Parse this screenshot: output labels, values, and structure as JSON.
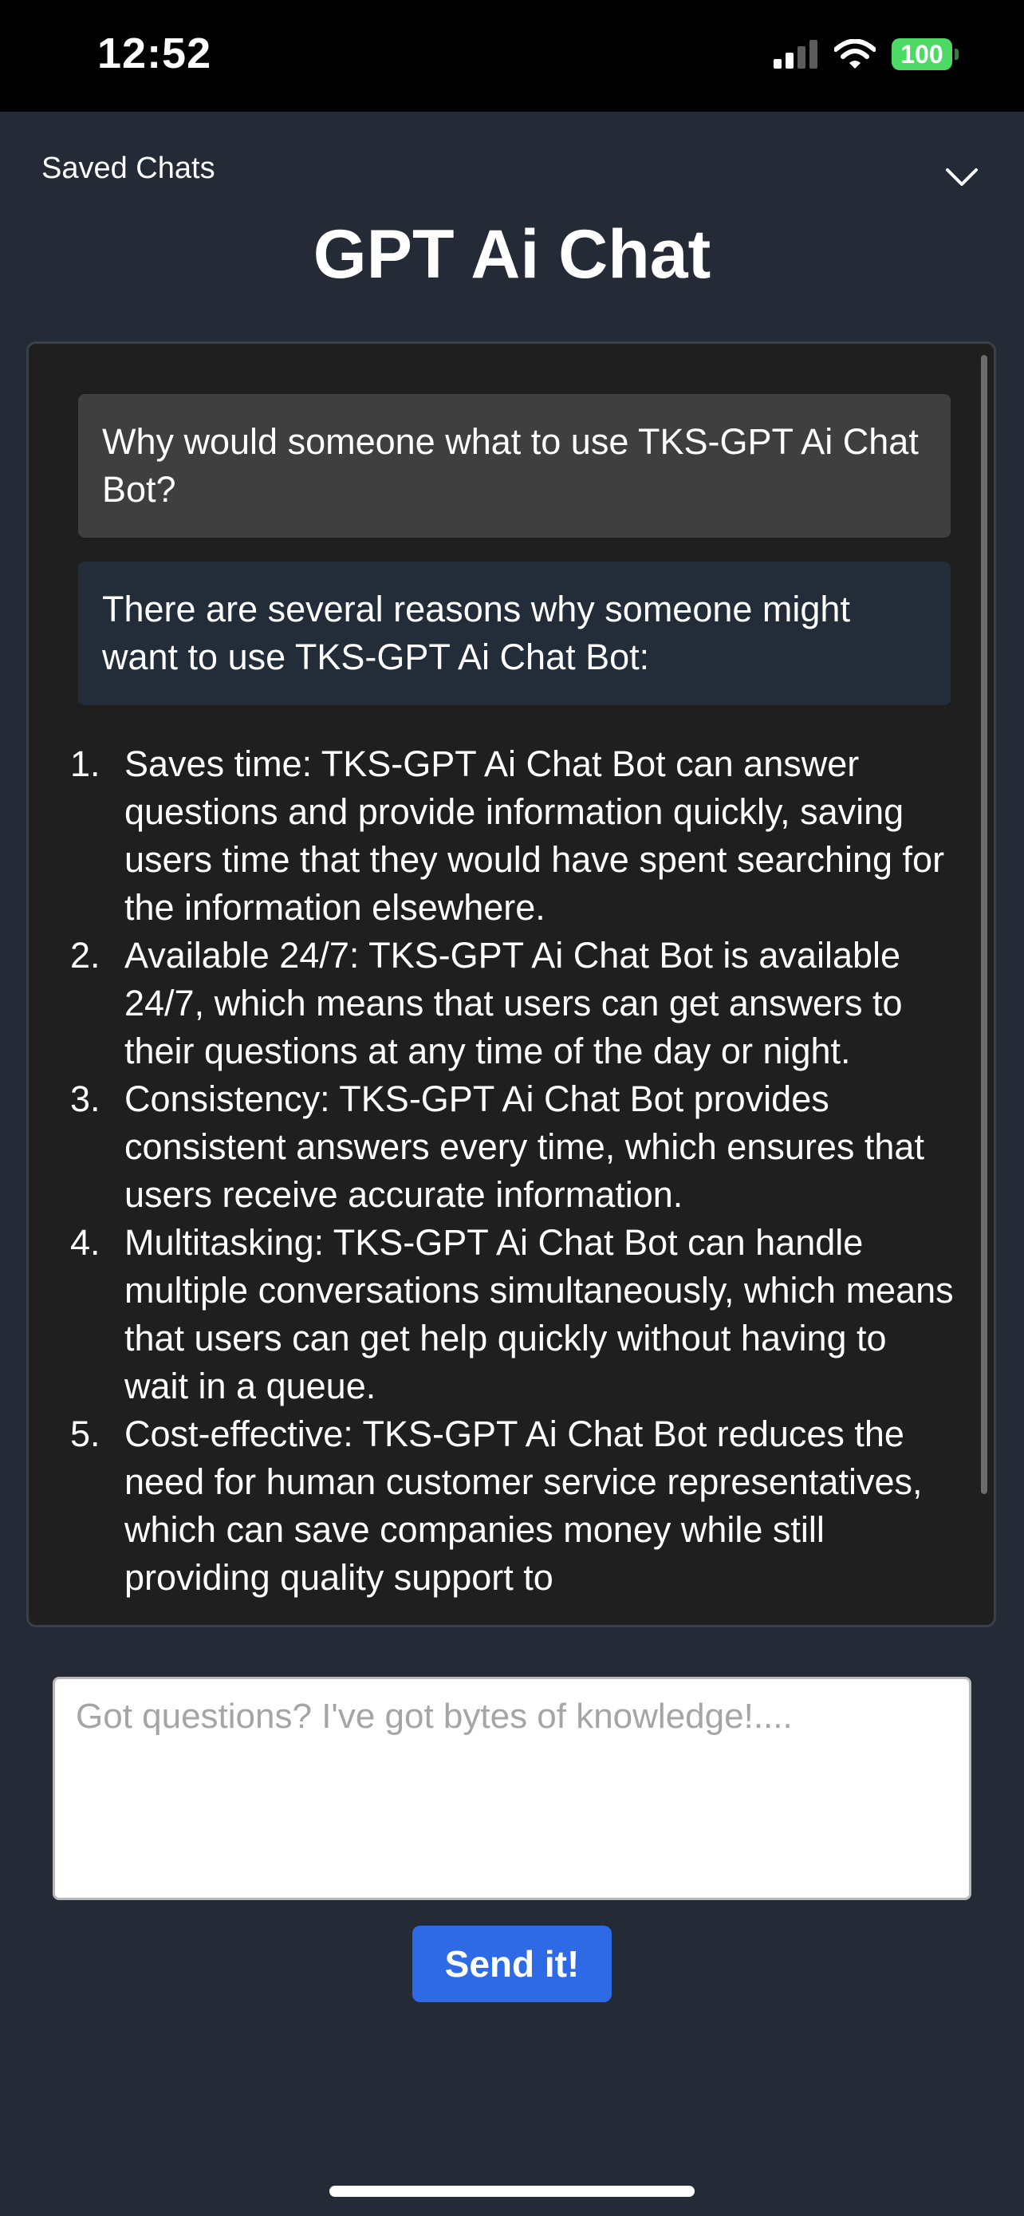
{
  "status_bar": {
    "time": "12:52",
    "battery": "100",
    "icons": [
      "signal-icon",
      "wifi-icon",
      "battery-icon"
    ],
    "battery_color": "#4cd964"
  },
  "header": {
    "saved_chats_label": "Saved Chats",
    "dropdown_icon": "chevron-down-icon",
    "title": "GPT Ai Chat"
  },
  "chat": {
    "messages": [
      {
        "role": "user",
        "text": "Why would someone what to use TKS-GPT Ai Chat Bot?"
      },
      {
        "role": "assistant",
        "text": "There are several reasons why someone might want to use TKS-GPT Ai Chat Bot:"
      }
    ],
    "list": [
      {
        "num": "1.",
        "text": "Saves time: TKS-GPT Ai Chat Bot can answer questions and provide information quickly, saving users time that they would have spent searching for the information elsewhere."
      },
      {
        "num": "2.",
        "text": "Available 24/7: TKS-GPT Ai Chat Bot is available 24/7, which means that users can get answers to their questions at any time of the day or night."
      },
      {
        "num": "3.",
        "text": "Consistency: TKS-GPT Ai Chat Bot provides consistent answers every time, which ensures that users receive accurate information."
      },
      {
        "num": "4.",
        "text": "Multitasking: TKS-GPT Ai Chat Bot can handle multiple conversations simultaneously, which means that users can get help quickly without having to wait in a queue."
      },
      {
        "num": "5.",
        "text": "Cost-effective: TKS-GPT Ai Chat Bot reduces the need for human customer service representatives, which can save companies money while still providing quality support to"
      }
    ]
  },
  "input": {
    "value": "",
    "placeholder": "Got questions? I've got bytes of knowledge!...."
  },
  "send_button": {
    "label": "Send it!",
    "color": "#2f6ae6"
  },
  "colors": {
    "background": "#242a36",
    "panel": "#1f1f1f",
    "user_bubble": "#3f3f3f",
    "assistant_bubble": "#232c39"
  }
}
